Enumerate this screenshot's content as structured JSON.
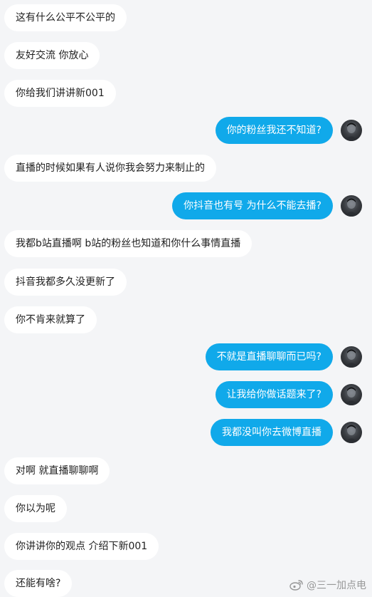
{
  "messages": [
    {
      "side": "in",
      "text": "这有什么公平不公平的"
    },
    {
      "side": "in",
      "text": "友好交流 你放心"
    },
    {
      "side": "in",
      "text": "你给我们讲讲新001"
    },
    {
      "side": "out",
      "text": "你的粉丝我还不知道?"
    },
    {
      "side": "in",
      "text": "直播的时候如果有人说你我会努力来制止的"
    },
    {
      "side": "out",
      "text": "你抖音也有号 为什么不能去播?"
    },
    {
      "side": "in",
      "text": "我都b站直播啊 b站的粉丝也知道和你什么事情直播"
    },
    {
      "side": "in",
      "text": "抖音我都多久没更新了"
    },
    {
      "side": "in",
      "text": "你不肯来就算了"
    },
    {
      "side": "out",
      "text": "不就是直播聊聊而已吗?"
    },
    {
      "side": "out",
      "text": "让我给你做话题来了?"
    },
    {
      "side": "out",
      "text": "我都没叫你去微博直播"
    },
    {
      "side": "in",
      "text": "对啊 就直播聊聊啊"
    },
    {
      "side": "in",
      "text": "你以为呢"
    },
    {
      "side": "in",
      "text": "你讲讲你的观点 介绍下新001"
    },
    {
      "side": "in",
      "text": "还能有啥?"
    }
  ],
  "watermark": {
    "icon": "weibo-icon",
    "text": "@三一加点电"
  },
  "colors": {
    "background": "#f4f5f7",
    "incoming_bubble": "#ffffff",
    "outgoing_bubble": "#10a9ea",
    "incoming_text": "#1f1f1f",
    "outgoing_text": "#ffffff"
  }
}
